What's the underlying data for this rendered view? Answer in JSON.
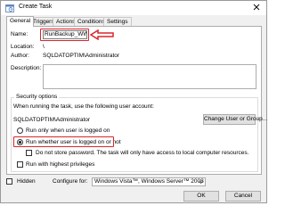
{
  "window": {
    "title": "Create Task"
  },
  "tabs": [
    {
      "label": "General"
    },
    {
      "label": "Triggers"
    },
    {
      "label": "Actions"
    },
    {
      "label": "Conditions"
    },
    {
      "label": "Settings"
    }
  ],
  "general": {
    "name_label": "Name:",
    "name_value": "RunBackup_WWI",
    "location_label": "Location:",
    "location_value": "\\",
    "author_label": "Author:",
    "author_value": "SQLDATOPTIM\\Administrator",
    "description_label": "Description:",
    "description_value": ""
  },
  "security": {
    "title": "Security options",
    "prompt": "When running the task, use the following user account:",
    "account": "SQLDATOPTIM\\Administrator",
    "change_button": "Change User or Group...",
    "radio_logged_on": "Run only when user is logged on",
    "radio_whether": "Run whether user is logged on or not",
    "selected_radio": "Run whether user is logged on or not",
    "no_store_password": "Do not store password.  The task will only have access to local computer resources.",
    "highest_privileges": "Run with highest privileges"
  },
  "footer": {
    "hidden_label": "Hidden",
    "configure_label": "Configure for:",
    "configure_value": "Windows Vista™, Windows Server™ 2008",
    "ok_button": "OK",
    "cancel_button": "Cancel"
  },
  "accent_colors": {
    "highlight": "#d8262d"
  }
}
